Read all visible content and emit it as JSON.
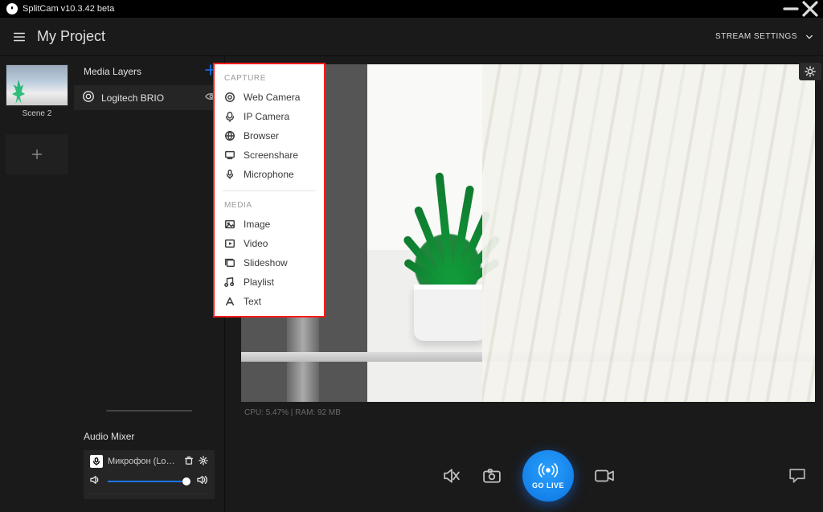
{
  "titlebar": {
    "title": "SplitCam v10.3.42 beta"
  },
  "projectbar": {
    "title": "My Project",
    "stream_settings_label": "STREAM SETTINGS"
  },
  "scenes": {
    "items": [
      {
        "label": "Scene 2"
      }
    ]
  },
  "layers": {
    "header": "Media Layers",
    "items": [
      {
        "name": "Logitech BRIO"
      }
    ]
  },
  "mixer": {
    "header": "Audio Mixer",
    "items": [
      {
        "name": "Микрофон  (Logitech..."
      }
    ]
  },
  "status": {
    "text": "CPU: 5.47% | RAM: 92 MB"
  },
  "golive": {
    "label": "GO LIVE"
  },
  "add_menu": {
    "groups": [
      {
        "label": "CAPTURE",
        "items": [
          {
            "id": "web-camera",
            "label": "Web Camera"
          },
          {
            "id": "ip-camera",
            "label": "IP Camera"
          },
          {
            "id": "browser",
            "label": "Browser"
          },
          {
            "id": "screenshare",
            "label": "Screenshare"
          },
          {
            "id": "microphone",
            "label": "Microphone"
          }
        ]
      },
      {
        "label": "MEDIA",
        "items": [
          {
            "id": "image",
            "label": "Image"
          },
          {
            "id": "video",
            "label": "Video"
          },
          {
            "id": "slideshow",
            "label": "Slideshow"
          },
          {
            "id": "playlist",
            "label": "Playlist"
          },
          {
            "id": "text",
            "label": "Text"
          }
        ]
      }
    ]
  }
}
